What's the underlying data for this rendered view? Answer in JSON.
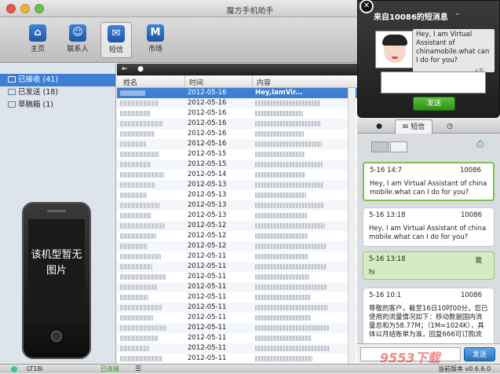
{
  "window": {
    "title": "魔方手机助手"
  },
  "toolbar": {
    "items": [
      {
        "label": "主页",
        "glyph": "⌂"
      },
      {
        "label": "联系人",
        "glyph": "☺"
      },
      {
        "label": "短信",
        "glyph": "✉"
      },
      {
        "label": "市场",
        "glyph": "M"
      }
    ],
    "active": "短信"
  },
  "sidebar": {
    "items": [
      {
        "label": "已接收 (41)"
      },
      {
        "label": "已发送 (18)"
      },
      {
        "label": "草稿箱 (1)"
      }
    ],
    "phone_text": "该机型暂无图片"
  },
  "message_list": {
    "columns": [
      "姓名",
      "时间",
      "内容"
    ],
    "rows": [
      {
        "time": "2012-05-16",
        "content": "Hey,IamVir..."
      },
      {
        "time": "2012-05-16",
        "content": ""
      },
      {
        "time": "2012-05-16",
        "content": ""
      },
      {
        "time": "2012-05-16",
        "content": ""
      },
      {
        "time": "2012-05-16",
        "content": ""
      },
      {
        "time": "2012-05-16",
        "content": ""
      },
      {
        "time": "2012-05-15",
        "content": ""
      },
      {
        "time": "2012-05-15",
        "content": ""
      },
      {
        "time": "2012-05-14",
        "content": ""
      },
      {
        "time": "2012-05-13",
        "content": ""
      },
      {
        "time": "2012-05-13",
        "content": ""
      },
      {
        "time": "2012-05-13",
        "content": ""
      },
      {
        "time": "2012-05-13",
        "content": ""
      },
      {
        "time": "2012-05-12",
        "content": ""
      },
      {
        "time": "2012-05-12",
        "content": ""
      },
      {
        "time": "2012-05-12",
        "content": ""
      },
      {
        "time": "2012-05-11",
        "content": ""
      },
      {
        "time": "2012-05-11",
        "content": ""
      },
      {
        "time": "2012-05-11",
        "content": ""
      },
      {
        "time": "2012-05-11",
        "content": ""
      },
      {
        "time": "2012-05-11",
        "content": ""
      },
      {
        "time": "2012-05-11",
        "content": ""
      },
      {
        "time": "2012-05-11",
        "content": ""
      },
      {
        "time": "2012-05-11",
        "content": ""
      },
      {
        "time": "2012-05-11",
        "content": ""
      },
      {
        "time": "2012-05-11",
        "content": ""
      },
      {
        "time": "2012-05-11",
        "content": ""
      }
    ]
  },
  "conversation": {
    "tabs": [
      {
        "label": ""
      },
      {
        "label": "短信"
      },
      {
        "label": ""
      }
    ],
    "messages": [
      {
        "date": "5-16 14:7",
        "from": "10086",
        "body": "Hey, I am Virtual Assistant of chinamobile.what can I do for you?",
        "outgoing": false
      },
      {
        "date": "5-16 13:18",
        "from": "10086",
        "body": "Hey, I am Virtual Assistant of chinamobile.what can I do for you?",
        "outgoing": false
      },
      {
        "date": "5-16 13:18",
        "from": "我",
        "body": "hi",
        "outgoing": true
      },
      {
        "date": "5-16 10:1",
        "from": "10086",
        "body": "尊敬的客户，截至16日10时00分，您已使用的流量情况如下：移动数据国内流量总和为58.77M；（1M=1024K），具体以月结账单为准，回复666可订购流",
        "outgoing": false
      }
    ],
    "send_label": "发送"
  },
  "popup": {
    "title": "来自10086的短消息",
    "message": "Hey, I am Virtual Assistant of chinamobile.what can I do for you?",
    "send_label": "发送"
  },
  "statusbar": {
    "device": "LT18i",
    "connection": "已连接",
    "version": "当前版本 v0.6.6.0"
  },
  "watermark": "9553下载"
}
